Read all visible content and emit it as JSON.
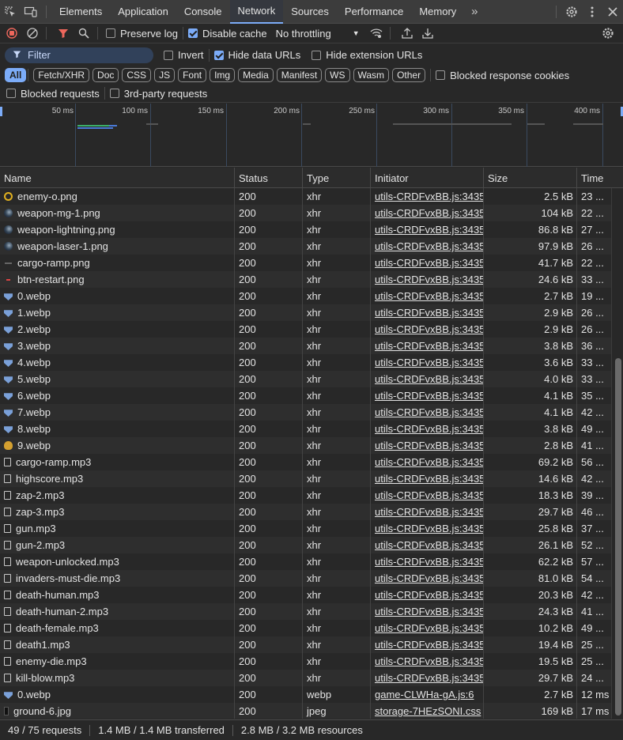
{
  "tabs": [
    {
      "label": "Elements"
    },
    {
      "label": "Application"
    },
    {
      "label": "Console"
    },
    {
      "label": "Network"
    },
    {
      "label": "Sources"
    },
    {
      "label": "Performance"
    },
    {
      "label": "Memory"
    }
  ],
  "toolbar": {
    "preserve_log": "Preserve log",
    "disable_cache": "Disable cache",
    "throttling": "No throttling"
  },
  "filterbar": {
    "filter_placeholder": "Filter",
    "invert": "Invert",
    "hide_data_urls": "Hide data URLs",
    "hide_extension_urls": "Hide extension URLs"
  },
  "types": [
    "All",
    "Fetch/XHR",
    "Doc",
    "CSS",
    "JS",
    "Font",
    "Img",
    "Media",
    "Manifest",
    "WS",
    "Wasm",
    "Other"
  ],
  "blocked_cookies": "Blocked response cookies",
  "blocked_requests": "Blocked requests",
  "third_party": "3rd-party requests",
  "overview_ticks": [
    "50 ms",
    "100 ms",
    "150 ms",
    "200 ms",
    "250 ms",
    "300 ms",
    "350 ms",
    "400 ms"
  ],
  "columns": {
    "name": "Name",
    "status": "Status",
    "type": "Type",
    "initiator": "Initiator",
    "size": "Size",
    "time": "Time"
  },
  "rows": [
    {
      "icon": "gold",
      "name": "enemy-o.png",
      "status": "200",
      "type": "xhr",
      "initiator": "utils-CRDFvxBB.js:3435",
      "size": "2.5 kB",
      "time": "23 ..."
    },
    {
      "icon": "orb",
      "name": "weapon-mg-1.png",
      "status": "200",
      "type": "xhr",
      "initiator": "utils-CRDFvxBB.js:3435",
      "size": "104 kB",
      "time": "22 ..."
    },
    {
      "icon": "orb",
      "name": "weapon-lightning.png",
      "status": "200",
      "type": "xhr",
      "initiator": "utils-CRDFvxBB.js:3435",
      "size": "86.8 kB",
      "time": "27 ..."
    },
    {
      "icon": "orb",
      "name": "weapon-laser-1.png",
      "status": "200",
      "type": "xhr",
      "initiator": "utils-CRDFvxBB.js:3435",
      "size": "97.9 kB",
      "time": "26 ..."
    },
    {
      "icon": "flat",
      "name": "cargo-ramp.png",
      "status": "200",
      "type": "xhr",
      "initiator": "utils-CRDFvxBB.js:3435",
      "size": "41.7 kB",
      "time": "22 ..."
    },
    {
      "icon": "red",
      "name": "btn-restart.png",
      "status": "200",
      "type": "xhr",
      "initiator": "utils-CRDFvxBB.js:3435",
      "size": "24.6 kB",
      "time": "33 ..."
    },
    {
      "icon": "shield",
      "name": "0.webp",
      "status": "200",
      "type": "xhr",
      "initiator": "utils-CRDFvxBB.js:3435",
      "size": "2.7 kB",
      "time": "19 ..."
    },
    {
      "icon": "shield",
      "name": "1.webp",
      "status": "200",
      "type": "xhr",
      "initiator": "utils-CRDFvxBB.js:3435",
      "size": "2.9 kB",
      "time": "26 ..."
    },
    {
      "icon": "shield",
      "name": "2.webp",
      "status": "200",
      "type": "xhr",
      "initiator": "utils-CRDFvxBB.js:3435",
      "size": "2.9 kB",
      "time": "26 ..."
    },
    {
      "icon": "shield",
      "name": "3.webp",
      "status": "200",
      "type": "xhr",
      "initiator": "utils-CRDFvxBB.js:3435",
      "size": "3.8 kB",
      "time": "36 ..."
    },
    {
      "icon": "shield",
      "name": "4.webp",
      "status": "200",
      "type": "xhr",
      "initiator": "utils-CRDFvxBB.js:3435",
      "size": "3.6 kB",
      "time": "33 ..."
    },
    {
      "icon": "shield",
      "name": "5.webp",
      "status": "200",
      "type": "xhr",
      "initiator": "utils-CRDFvxBB.js:3435",
      "size": "4.0 kB",
      "time": "33 ..."
    },
    {
      "icon": "shield",
      "name": "6.webp",
      "status": "200",
      "type": "xhr",
      "initiator": "utils-CRDFvxBB.js:3435",
      "size": "4.1 kB",
      "time": "35 ..."
    },
    {
      "icon": "shield",
      "name": "7.webp",
      "status": "200",
      "type": "xhr",
      "initiator": "utils-CRDFvxBB.js:3435",
      "size": "4.1 kB",
      "time": "42 ..."
    },
    {
      "icon": "shield",
      "name": "8.webp",
      "status": "200",
      "type": "xhr",
      "initiator": "utils-CRDFvxBB.js:3435",
      "size": "3.8 kB",
      "time": "49 ..."
    },
    {
      "icon": "bag",
      "name": "9.webp",
      "status": "200",
      "type": "xhr",
      "initiator": "utils-CRDFvxBB.js:3435",
      "size": "2.8 kB",
      "time": "41 ..."
    },
    {
      "icon": "doc",
      "name": "cargo-ramp.mp3",
      "status": "200",
      "type": "xhr",
      "initiator": "utils-CRDFvxBB.js:3435",
      "size": "69.2 kB",
      "time": "56 ..."
    },
    {
      "icon": "doc",
      "name": "highscore.mp3",
      "status": "200",
      "type": "xhr",
      "initiator": "utils-CRDFvxBB.js:3435",
      "size": "14.6 kB",
      "time": "42 ..."
    },
    {
      "icon": "doc",
      "name": "zap-2.mp3",
      "status": "200",
      "type": "xhr",
      "initiator": "utils-CRDFvxBB.js:3435",
      "size": "18.3 kB",
      "time": "39 ..."
    },
    {
      "icon": "doc",
      "name": "zap-3.mp3",
      "status": "200",
      "type": "xhr",
      "initiator": "utils-CRDFvxBB.js:3435",
      "size": "29.7 kB",
      "time": "46 ..."
    },
    {
      "icon": "doc",
      "name": "gun.mp3",
      "status": "200",
      "type": "xhr",
      "initiator": "utils-CRDFvxBB.js:3435",
      "size": "25.8 kB",
      "time": "37 ..."
    },
    {
      "icon": "doc",
      "name": "gun-2.mp3",
      "status": "200",
      "type": "xhr",
      "initiator": "utils-CRDFvxBB.js:3435",
      "size": "26.1 kB",
      "time": "52 ..."
    },
    {
      "icon": "doc",
      "name": "weapon-unlocked.mp3",
      "status": "200",
      "type": "xhr",
      "initiator": "utils-CRDFvxBB.js:3435",
      "size": "62.2 kB",
      "time": "57 ..."
    },
    {
      "icon": "doc",
      "name": "invaders-must-die.mp3",
      "status": "200",
      "type": "xhr",
      "initiator": "utils-CRDFvxBB.js:3435",
      "size": "81.0 kB",
      "time": "54 ..."
    },
    {
      "icon": "doc",
      "name": "death-human.mp3",
      "status": "200",
      "type": "xhr",
      "initiator": "utils-CRDFvxBB.js:3435",
      "size": "20.3 kB",
      "time": "42 ..."
    },
    {
      "icon": "doc",
      "name": "death-human-2.mp3",
      "status": "200",
      "type": "xhr",
      "initiator": "utils-CRDFvxBB.js:3435",
      "size": "24.3 kB",
      "time": "41 ..."
    },
    {
      "icon": "doc",
      "name": "death-female.mp3",
      "status": "200",
      "type": "xhr",
      "initiator": "utils-CRDFvxBB.js:3435",
      "size": "10.2 kB",
      "time": "49 ..."
    },
    {
      "icon": "doc",
      "name": "death1.mp3",
      "status": "200",
      "type": "xhr",
      "initiator": "utils-CRDFvxBB.js:3435",
      "size": "19.4 kB",
      "time": "25 ..."
    },
    {
      "icon": "doc",
      "name": "enemy-die.mp3",
      "status": "200",
      "type": "xhr",
      "initiator": "utils-CRDFvxBB.js:3435",
      "size": "19.5 kB",
      "time": "25 ..."
    },
    {
      "icon": "doc",
      "name": "kill-blow.mp3",
      "status": "200",
      "type": "xhr",
      "initiator": "utils-CRDFvxBB.js:3435",
      "size": "29.7 kB",
      "time": "24 ..."
    },
    {
      "icon": "shield",
      "name": "0.webp",
      "status": "200",
      "type": "webp",
      "initiator": "game-CLWHa-gA.js:6",
      "size": "2.7 kB",
      "time": "12 ms"
    },
    {
      "icon": "jpg",
      "name": "ground-6.jpg",
      "status": "200",
      "type": "jpeg",
      "initiator": "storage-7HEzSONI.css",
      "size": "169 kB",
      "time": "17 ms"
    }
  ],
  "status": {
    "requests": "49 / 75 requests",
    "transferred": "1.4 MB / 1.4 MB transferred",
    "resources": "2.8 MB / 3.2 MB resources"
  }
}
